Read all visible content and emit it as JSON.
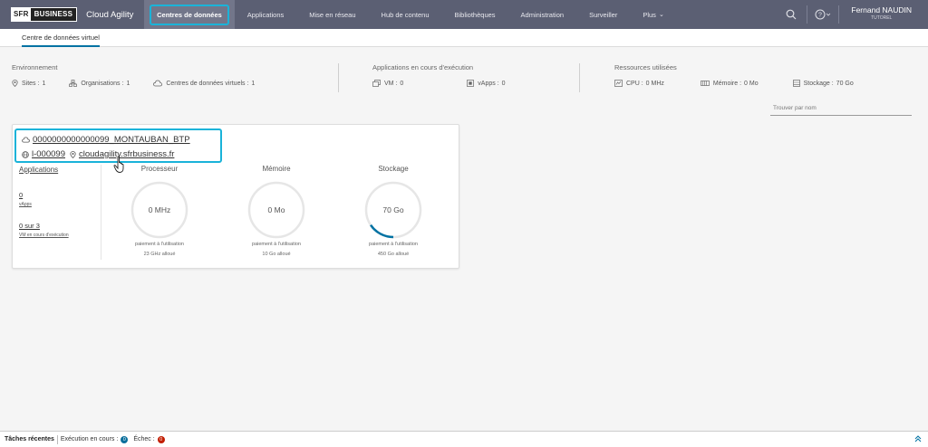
{
  "colors": {
    "header_bg": "#5b5f73",
    "accent": "#1ab3d9",
    "link_blue": "#0072a3",
    "badge_running": "#0b6f9c",
    "badge_failed": "#c21d00",
    "gauge_fill": "#0072a3"
  },
  "header": {
    "logo": {
      "sfr": "SFR",
      "business": "BUSINESS"
    },
    "app_name": "Cloud Agility",
    "nav": [
      {
        "label": "Centres de données"
      },
      {
        "label": "Applications"
      },
      {
        "label": "Mise en réseau"
      },
      {
        "label": "Hub de contenu"
      },
      {
        "label": "Bibliothèques"
      },
      {
        "label": "Administration"
      },
      {
        "label": "Surveiller"
      },
      {
        "label": "Plus"
      }
    ],
    "icons": [
      "search-icon",
      "help-icon",
      "chevron-down-icon"
    ],
    "user": {
      "name": "Fernand NAUDIN",
      "role": "TUTOREL"
    }
  },
  "subtabs": [
    {
      "label": "Centre de données virtuel"
    }
  ],
  "summary": {
    "environment": {
      "title": "Environnement",
      "items": [
        {
          "label": "Sites :",
          "value": "1",
          "icon": "location-icon"
        },
        {
          "label": "Organisations :",
          "value": "1",
          "icon": "organization-icon"
        },
        {
          "label": "Centres de données virtuels :",
          "value": "1",
          "icon": "cloud-icon"
        }
      ]
    },
    "running": {
      "title": "Applications en cours d'exécution",
      "items": [
        {
          "label": "VM :",
          "value": "0",
          "icon": "vm-icon"
        },
        {
          "label": "vApps :",
          "value": "0",
          "icon": "vapp-icon"
        }
      ]
    },
    "resources": {
      "title": "Ressources utilisées",
      "items": [
        {
          "label": "CPU :",
          "value": "0 MHz",
          "icon": "cpu-icon"
        },
        {
          "label": "Mémoire :",
          "value": "0 Mo",
          "icon": "memory-icon"
        },
        {
          "label": "Stockage :",
          "value": "70 Go",
          "icon": "storage-icon"
        }
      ]
    }
  },
  "search": {
    "placeholder": "Trouver par nom"
  },
  "vdc_card": {
    "name": "0000000000000099_MONTAUBAN_BTP",
    "org": "l-000099",
    "site": "cloudagility.sfrbusiness.fr",
    "applications_label": "Applications",
    "vapps_count": "0",
    "vapps_label": "vApps",
    "vms_running": "0 sur 3",
    "vms_running_label": "VM en cours d'exécution",
    "gauges": [
      {
        "title": "Processeur",
        "value": "0 MHz",
        "note": "paiement à l'utilisation",
        "allocated": "23 GHz alloué",
        "fraction": 0
      },
      {
        "title": "Mémoire",
        "value": "0 Mo",
        "note": "paiement à l'utilisation",
        "allocated": "10 Go alloué",
        "fraction": 0
      },
      {
        "title": "Stockage",
        "value": "70 Go",
        "note": "paiement à l'utilisation",
        "allocated": "450 Go alloué",
        "fraction": 0.156
      }
    ]
  },
  "footer": {
    "recent_tasks": "Tâches récentes",
    "running_label": "Exécution en cours :",
    "running_count": "0",
    "failed_label": "Échec :",
    "failed_count": "0"
  }
}
